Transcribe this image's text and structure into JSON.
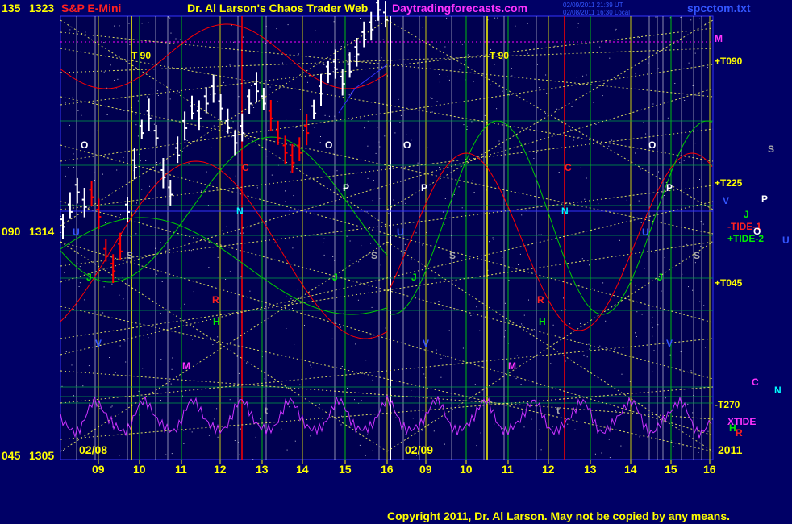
{
  "header": {
    "left_scale": "135",
    "price_top": "1323",
    "symbol": "S&P E-Mini",
    "title": "Dr. Al Larson's Chaos Trader Web",
    "site": "Daytradingforecasts.com",
    "timestamp_1": "02/09/2011 21:39 UT",
    "timestamp_2": "02/08/2011 16:30 Local",
    "filename": "spcctom.txt"
  },
  "left_axis": {
    "mid_scale": "090",
    "mid_price": "1314",
    "bottom_scale": "045",
    "bottom_price": "1305"
  },
  "day_labels": {
    "first": "02/08",
    "second": "02/09",
    "year": "2011"
  },
  "hour_ticks": [
    "09",
    "10",
    "11",
    "12",
    "13",
    "14",
    "15",
    "16",
    "09",
    "10",
    "11",
    "12",
    "13",
    "14",
    "15",
    "16"
  ],
  "right_labels": {
    "m": "M",
    "t090": "+T090",
    "t225": "+T225",
    "v": "V",
    "p": "P",
    "s": "S",
    "j": "J",
    "o": "O",
    "tide1": "-TIDE-1",
    "tide2": "+TIDE-2",
    "u": "U",
    "t045": "+T045",
    "c": "C",
    "n": "N",
    "t270": "-T270",
    "xtide": "XTIDE",
    "h": "H",
    "r": "R"
  },
  "in_chart_labels": {
    "t90": "T  90",
    "o": "O",
    "p": "P",
    "s": "S",
    "c": "C",
    "n": "N",
    "j": "J",
    "r": "R",
    "h": "H",
    "v": "V",
    "m": "M",
    "t": "t",
    "u": "U"
  },
  "footer": {
    "copyright": "Copyright 2011, Dr. Al Larson. May not be copied by any means."
  },
  "colors": {
    "background": "#000066",
    "plot_bg": "#000050",
    "yellow": "#ffff00",
    "red": "#ff0000",
    "green": "#00ee00",
    "magenta": "#ff00ff",
    "cyan": "#00ffff",
    "white": "#ffffff",
    "blue": "#3333ff"
  },
  "chart_data": {
    "type": "candlestick",
    "y_scale": {
      "price_min": 1305,
      "price_max": 1323
    },
    "days": [
      "02/08",
      "02/09"
    ],
    "hours": [
      9,
      10,
      11,
      12,
      13,
      14,
      15,
      16
    ],
    "price_path_02_08": [
      1314.6,
      1315.2,
      1316.0,
      1315.4,
      1315.8,
      1315.0,
      1313.4,
      1312.8,
      1313.6,
      1315.2,
      1317.0,
      1318.4,
      1319.0,
      1318.2,
      1316.6,
      1315.9,
      1317.5,
      1318.6,
      1319.2,
      1319.0,
      1319.6,
      1320.0,
      1319.4,
      1318.6,
      1318.0,
      1318.4,
      1319.6,
      1320.1,
      1319.6,
      1319.0,
      1318.2,
      1317.6,
      1317.2,
      1317.6,
      1318.4,
      1319.2,
      1320.0,
      1320.8,
      1321.0,
      1320.4,
      1320.9,
      1321.6,
      1322.2,
      1322.6,
      1323.4,
      1323.0
    ]
  }
}
